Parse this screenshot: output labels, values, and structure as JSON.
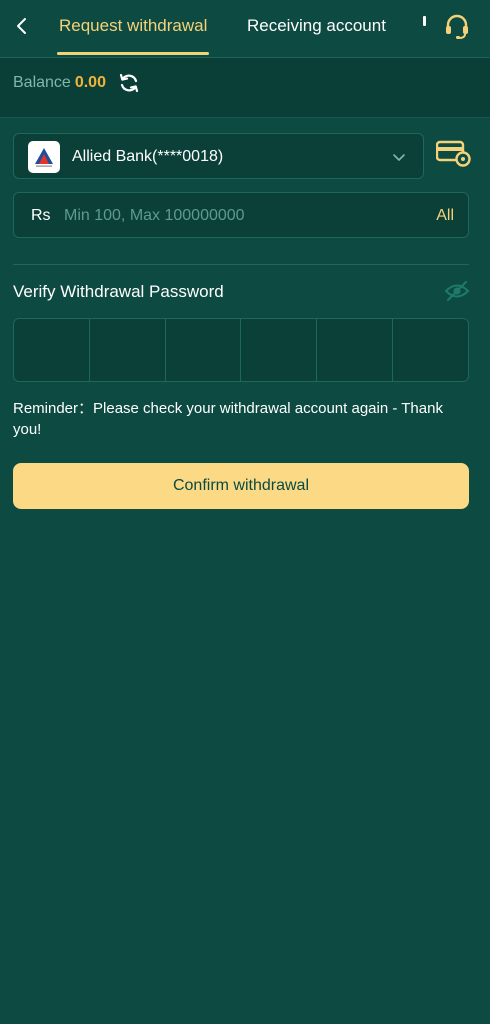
{
  "header": {
    "tabs": [
      {
        "label": "Request withdrawal",
        "active": true
      },
      {
        "label": "Receiving account",
        "active": false
      }
    ]
  },
  "balance": {
    "label": "Balance",
    "value": "0.00"
  },
  "bank": {
    "name": "Allied Bank(****0018)"
  },
  "amount": {
    "currency": "Rs",
    "placeholder": "Min 100, Max 100000000",
    "all_label": "All"
  },
  "password": {
    "label": "Verify Withdrawal Password",
    "digits": 6
  },
  "reminder": "Reminder：Please check your withdrawal account again - Thank you!",
  "confirm_label": "Confirm withdrawal",
  "colors": {
    "background": "#0c4a42",
    "accent": "#f5d27a",
    "balance_value": "#f1b43a",
    "button": "#fbd985"
  }
}
